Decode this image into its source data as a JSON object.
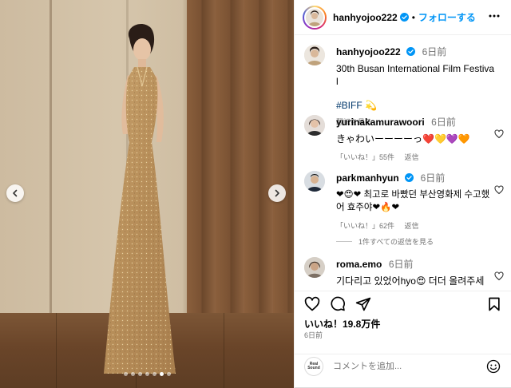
{
  "post": {
    "author": "hanhyojoo222",
    "follow_label": "フォローする",
    "separator": "•",
    "caption_time": "6日前",
    "caption_line": "30th Busan International Film Festival",
    "hashtag": "#BIFF",
    "hashtag_emoji": "💫",
    "translate_label": "翻訳を見る",
    "carousel": {
      "slides": 7,
      "active_index": 5
    }
  },
  "comments": [
    {
      "user": "yurinakamurawoori",
      "time": "6日前",
      "text": "きゃわいーーーーっ❤️💛💜🧡",
      "likes": "「いいね！」55件",
      "reply": "返信"
    },
    {
      "user": "parkmanhyun",
      "verified": true,
      "time": "6日前",
      "text": "❤😍❤ 최고로 바빴던 부산영화제 수고했어 효주야❤🔥❤",
      "likes": "「いいね！」62件",
      "reply": "返信"
    },
    {
      "user": "roma.emo",
      "time": "6日前",
      "text": "기다리고 있었어hyo😍 더더 올려주세"
    }
  ],
  "view_replies": "1件すべての返信を見る",
  "footer": {
    "likes": "いいね！19.8万件",
    "date": "6日前",
    "add_comment_placeholder": "コメントを追加...",
    "commenter_logo_line1": "Real",
    "commenter_logo_line2": "Sound"
  },
  "colors": {
    "follow": "#0095f6",
    "hashtag": "#00376b",
    "verified": "#0095f6",
    "muted": "#737373"
  }
}
